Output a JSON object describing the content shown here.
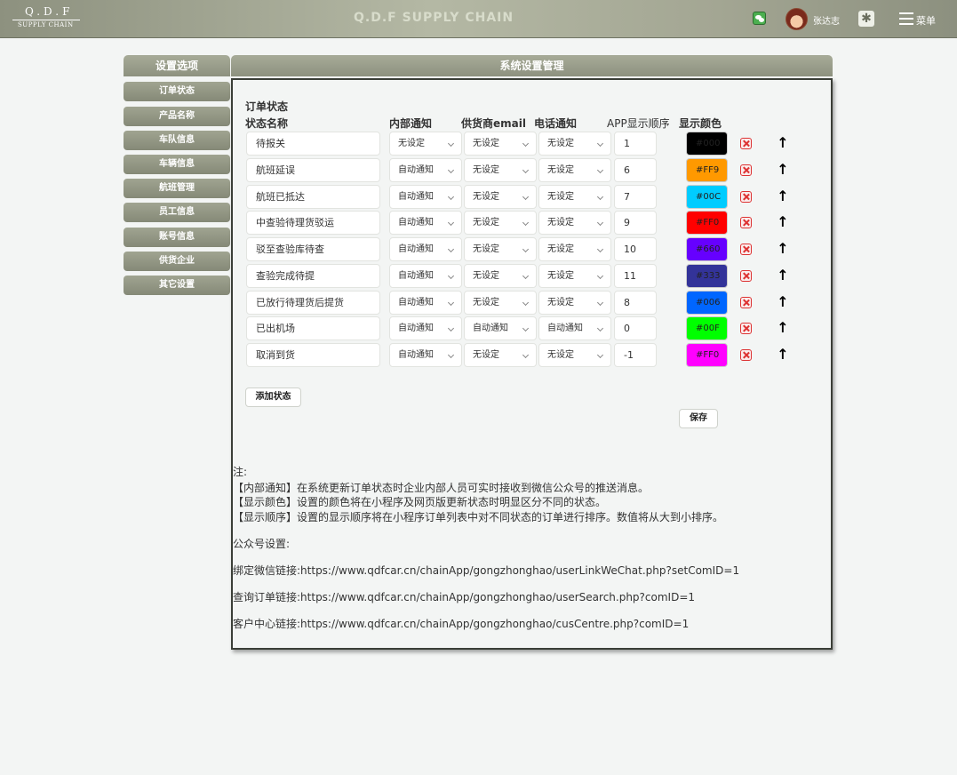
{
  "header": {
    "logo_main": "Q.D.F",
    "logo_sub": "SUPPLY CHAIN",
    "app_title": "Q.D.F SUPPLY CHAIN",
    "user_name": "张达志",
    "menu_label": "菜单"
  },
  "sidebar": {
    "title": "设置选项",
    "items": [
      "订单状态",
      "产品名称",
      "车队信息",
      "车辆信息",
      "航班管理",
      "员工信息",
      "账号信息",
      "供货企业",
      "其它设置"
    ]
  },
  "panel": {
    "title": "系统设置管理",
    "section_title": "订单状态",
    "columns": {
      "name": "状态名称",
      "internal": "内部通知",
      "supplier_email": "供货商email",
      "phone": "电话通知",
      "app_order": "APP显示顺序",
      "color": "显示颜色"
    },
    "rows": [
      {
        "name": "待报关",
        "internal": "无设定",
        "email": "无设定",
        "phone": "无设定",
        "order": "1",
        "color_text": "#000",
        "color": "#000000"
      },
      {
        "name": "航班延误",
        "internal": "自动通知",
        "email": "无设定",
        "phone": "无设定",
        "order": "6",
        "color_text": "#FF9",
        "color": "#FF9900"
      },
      {
        "name": "航班已抵达",
        "internal": "自动通知",
        "email": "无设定",
        "phone": "无设定",
        "order": "7",
        "color_text": "#00C",
        "color": "#00CCFF"
      },
      {
        "name": "中查验待理货驳运",
        "internal": "自动通知",
        "email": "无设定",
        "phone": "无设定",
        "order": "9",
        "color_text": "#FF0",
        "color": "#FF0000"
      },
      {
        "name": "驳至查验库待查",
        "internal": "自动通知",
        "email": "无设定",
        "phone": "无设定",
        "order": "10",
        "color_text": "#660",
        "color": "#6600FF"
      },
      {
        "name": "查验完成待提",
        "internal": "自动通知",
        "email": "无设定",
        "phone": "无设定",
        "order": "11",
        "color_text": "#333",
        "color": "#333399"
      },
      {
        "name": "已放行待理货后提货",
        "internal": "自动通知",
        "email": "无设定",
        "phone": "无设定",
        "order": "8",
        "color_text": "#006",
        "color": "#0066FF"
      },
      {
        "name": "已出机场",
        "internal": "自动通知",
        "email": "自动通知",
        "phone": "自动通知",
        "order": "0",
        "color_text": "#00F",
        "color": "#00FF00"
      },
      {
        "name": "取消到货",
        "internal": "自动通知",
        "email": "无设定",
        "phone": "无设定",
        "order": "-1",
        "color_text": "#FF0",
        "color": "#FF00FF"
      }
    ],
    "add_button": "添加状态",
    "save_button": "保存",
    "notes": [
      "注:",
      "【内部通知】在系统更新订单状态时企业内部人员可实时接收到微信公众号的推送消息。",
      "【显示颜色】设置的颜色将在小程序及网页版更新状态时明显区分不同的状态。",
      "【显示顺序】设置的显示顺序将在小程序订单列表中对不同状态的订单进行排序。数值将从大到小排序。"
    ],
    "wechat_settings_title": "公众号设置:",
    "links": [
      {
        "label": "绑定微信链接:",
        "url": "https://www.qdfcar.cn/chainApp/gongzhonghao/userLinkWeChat.php?setComID=1"
      },
      {
        "label": "查询订单链接:",
        "url": "https://www.qdfcar.cn/chainApp/gongzhonghao/userSearch.php?comID=1"
      },
      {
        "label": "客户中心链接:",
        "url": "https://www.qdfcar.cn/chainApp/gongzhonghao/cusCentre.php?comID=1"
      }
    ]
  }
}
